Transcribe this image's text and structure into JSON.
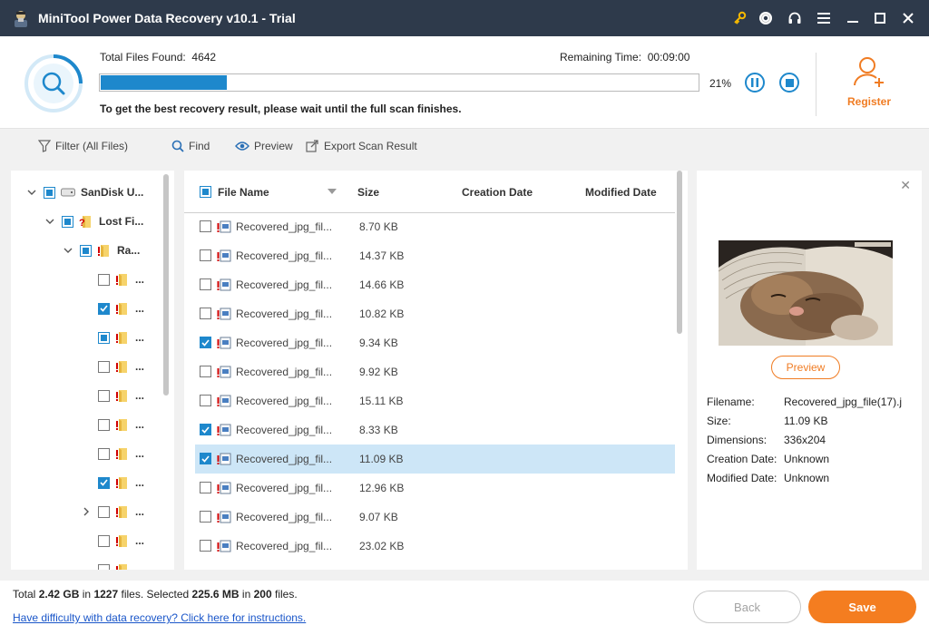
{
  "window": {
    "title": "MiniTool Power Data Recovery v10.1 - Trial",
    "icons": [
      "key-icon",
      "disc-icon",
      "headset-icon",
      "menu-icon",
      "minimize-icon",
      "maximize-icon",
      "close-icon"
    ]
  },
  "scan": {
    "total_label": "Total Files Found:",
    "total_value": "4642",
    "remaining_label": "Remaining Time:",
    "remaining_value": "00:09:00",
    "percent": "21%",
    "progress": 0.21,
    "hint": "To get the best recovery result, please wait until the full scan finishes.",
    "register_label": "Register"
  },
  "toolbar": {
    "filter": "Filter (All Files)",
    "find": "Find",
    "preview": "Preview",
    "export": "Export Scan Result"
  },
  "tree": {
    "root": "SanDisk U...",
    "lost": "Lost Fi...",
    "raw": "Ra...",
    "ellipsis": "...",
    "children": [
      {
        "state": "unchecked",
        "expandable": false
      },
      {
        "state": "checked",
        "expandable": false
      },
      {
        "state": "partial",
        "expandable": false
      },
      {
        "state": "unchecked",
        "expandable": false
      },
      {
        "state": "unchecked",
        "expandable": false
      },
      {
        "state": "unchecked",
        "expandable": false
      },
      {
        "state": "unchecked",
        "expandable": false
      },
      {
        "state": "checked",
        "expandable": false
      },
      {
        "state": "unchecked",
        "expandable": true
      },
      {
        "state": "unchecked",
        "expandable": false
      },
      {
        "state": "unchecked",
        "expandable": false
      }
    ]
  },
  "list": {
    "columns": {
      "file_name": "File Name",
      "size": "Size",
      "creation_date": "Creation Date",
      "modified_date": "Modified Date"
    },
    "rows": [
      {
        "name": "Recovered_jpg_fil...",
        "size": "8.70 KB",
        "checked": false,
        "selected": false
      },
      {
        "name": "Recovered_jpg_fil...",
        "size": "14.37 KB",
        "checked": false,
        "selected": false
      },
      {
        "name": "Recovered_jpg_fil...",
        "size": "14.66 KB",
        "checked": false,
        "selected": false
      },
      {
        "name": "Recovered_jpg_fil...",
        "size": "10.82 KB",
        "checked": false,
        "selected": false
      },
      {
        "name": "Recovered_jpg_fil...",
        "size": "9.34 KB",
        "checked": true,
        "selected": false
      },
      {
        "name": "Recovered_jpg_fil...",
        "size": "9.92 KB",
        "checked": false,
        "selected": false
      },
      {
        "name": "Recovered_jpg_fil...",
        "size": "15.11 KB",
        "checked": false,
        "selected": false
      },
      {
        "name": "Recovered_jpg_fil...",
        "size": "8.33 KB",
        "checked": true,
        "selected": false
      },
      {
        "name": "Recovered_jpg_fil...",
        "size": "11.09 KB",
        "checked": true,
        "selected": true
      },
      {
        "name": "Recovered_jpg_fil...",
        "size": "12.96 KB",
        "checked": false,
        "selected": false
      },
      {
        "name": "Recovered_jpg_fil...",
        "size": "9.07 KB",
        "checked": false,
        "selected": false
      },
      {
        "name": "Recovered_jpg_fil...",
        "size": "23.02 KB",
        "checked": false,
        "selected": false
      }
    ]
  },
  "preview": {
    "button": "Preview",
    "info": [
      {
        "label": "Filename:",
        "value": "Recovered_jpg_file(17).j"
      },
      {
        "label": "Size:",
        "value": "11.09 KB"
      },
      {
        "label": "Dimensions:",
        "value": "336x204"
      },
      {
        "label": "Creation Date:",
        "value": "Unknown"
      },
      {
        "label": "Modified Date:",
        "value": "Unknown"
      }
    ]
  },
  "footer": {
    "total_prefix": "Total",
    "total_size": "2.42 GB",
    "in1": "in",
    "total_files": "1227",
    "files_selected_prefix": "files.  Selected",
    "selected_size": "225.6 MB",
    "in2": "in",
    "selected_files": "200",
    "files_suffix": "files.",
    "help_link": "Have difficulty with data recovery? Click here for instructions.",
    "back": "Back",
    "save": "Save"
  },
  "colors": {
    "titlebar": "#2e3a4b",
    "accent_blue": "#1e88cc",
    "accent_orange": "#f47d20",
    "selected_row": "#cde6f7"
  }
}
